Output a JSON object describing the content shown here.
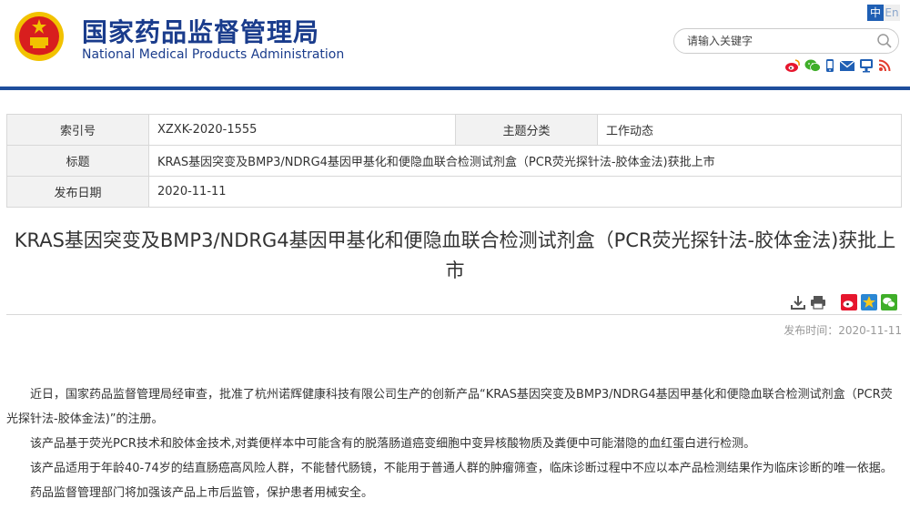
{
  "header": {
    "title_cn": "国家药品监督管理局",
    "title_en": "National Medical Products Administration",
    "lang_zh": "中",
    "lang_en": "En",
    "search_placeholder": "请输入关键字",
    "social_icons": [
      "weibo-icon",
      "wechat-icon",
      "mobile-icon",
      "mail-icon",
      "feedback-icon",
      "rss-icon"
    ]
  },
  "meta": {
    "index_label": "索引号",
    "index_value": "XZXK-2020-1555",
    "topic_label": "主题分类",
    "topic_value": "工作动态",
    "title_label": "标题",
    "title_value": "KRAS基因突变及BMP3/NDRG4基因甲基化和便隐血联合检测试剂盒（PCR荧光探针法-胶体金法)获批上市",
    "date_label": "发布日期",
    "date_value": "2020-11-11"
  },
  "article": {
    "title_line1": "KRAS基因突变及BMP3/NDRG4基因甲基化和便隐血联合检测试剂盒（PCR荧光探针法-胶体金法)获批上",
    "title_line2": "市",
    "publish_time": "发布时间：2020-11-11",
    "paragraphs": [
      "近日，国家药品监督管理局经审查，批准了杭州诺辉健康科技有限公司生产的创新产品“KRAS基因突变及BMP3/NDRG4基因甲基化和便隐血联合检测试剂盒（PCR荧光探针法-胶体金法)”的注册。",
      "该产品基于荧光PCR技术和胶体金技术,对粪便样本中可能含有的脱落肠道癌变细胞中变异核酸物质及粪便中可能潜隐的血红蛋白进行检测。",
      "该产品适用于年龄40-74岁的结直肠癌高风险人群，不能替代肠镜，不能用于普通人群的肿瘤筛查，临床诊断过程中不应以本产品检测结果作为临床诊断的唯一依据。",
      "药品监督管理部门将加强该产品上市后监管，保护患者用械安全。"
    ]
  },
  "colors": {
    "brand_blue": "#1a3c8c",
    "rule_blue": "#1f4e9c",
    "emblem_red": "#d81e1e",
    "emblem_gold": "#f2c200"
  }
}
